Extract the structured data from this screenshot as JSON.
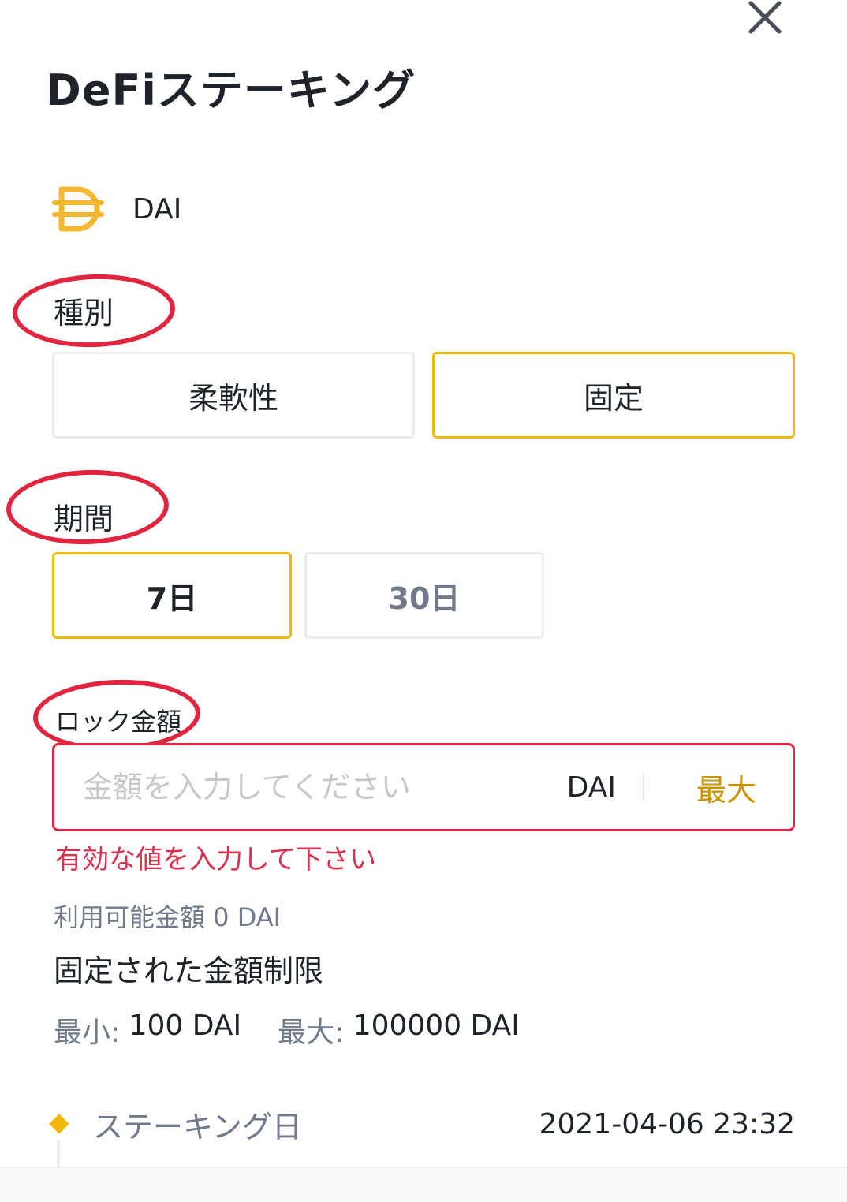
{
  "header": {
    "title": "DeFiステーキング",
    "close_icon": "close-icon"
  },
  "coin": {
    "icon": "dai-icon",
    "name": "DAI",
    "color": "#f4b731"
  },
  "type_section": {
    "label": "種別",
    "options": [
      {
        "label": "柔軟性",
        "selected": false
      },
      {
        "label": "固定",
        "selected": true
      }
    ]
  },
  "period_section": {
    "label": "期間",
    "options": [
      {
        "label": "7日",
        "selected": true
      },
      {
        "label": "30日",
        "selected": false
      }
    ]
  },
  "amount_section": {
    "label": "ロック金額",
    "placeholder": "金額を入力してください",
    "value": "",
    "unit": "DAI",
    "max_label": "最大",
    "error": "有効な値を入力して下さい"
  },
  "available": "利用可能金額 0 DAI",
  "limits": {
    "title": "固定された金額制限",
    "min_label": "最小:",
    "min_value": "100 DAI",
    "max_label": "最大:",
    "max_value": "100000 DAI"
  },
  "staking_date": {
    "label": "ステーキング日",
    "value": "2021-04-06 23:32"
  },
  "colors": {
    "accent": "#f0b90b",
    "error": "#e0263f",
    "annotation": "#e0263f"
  }
}
